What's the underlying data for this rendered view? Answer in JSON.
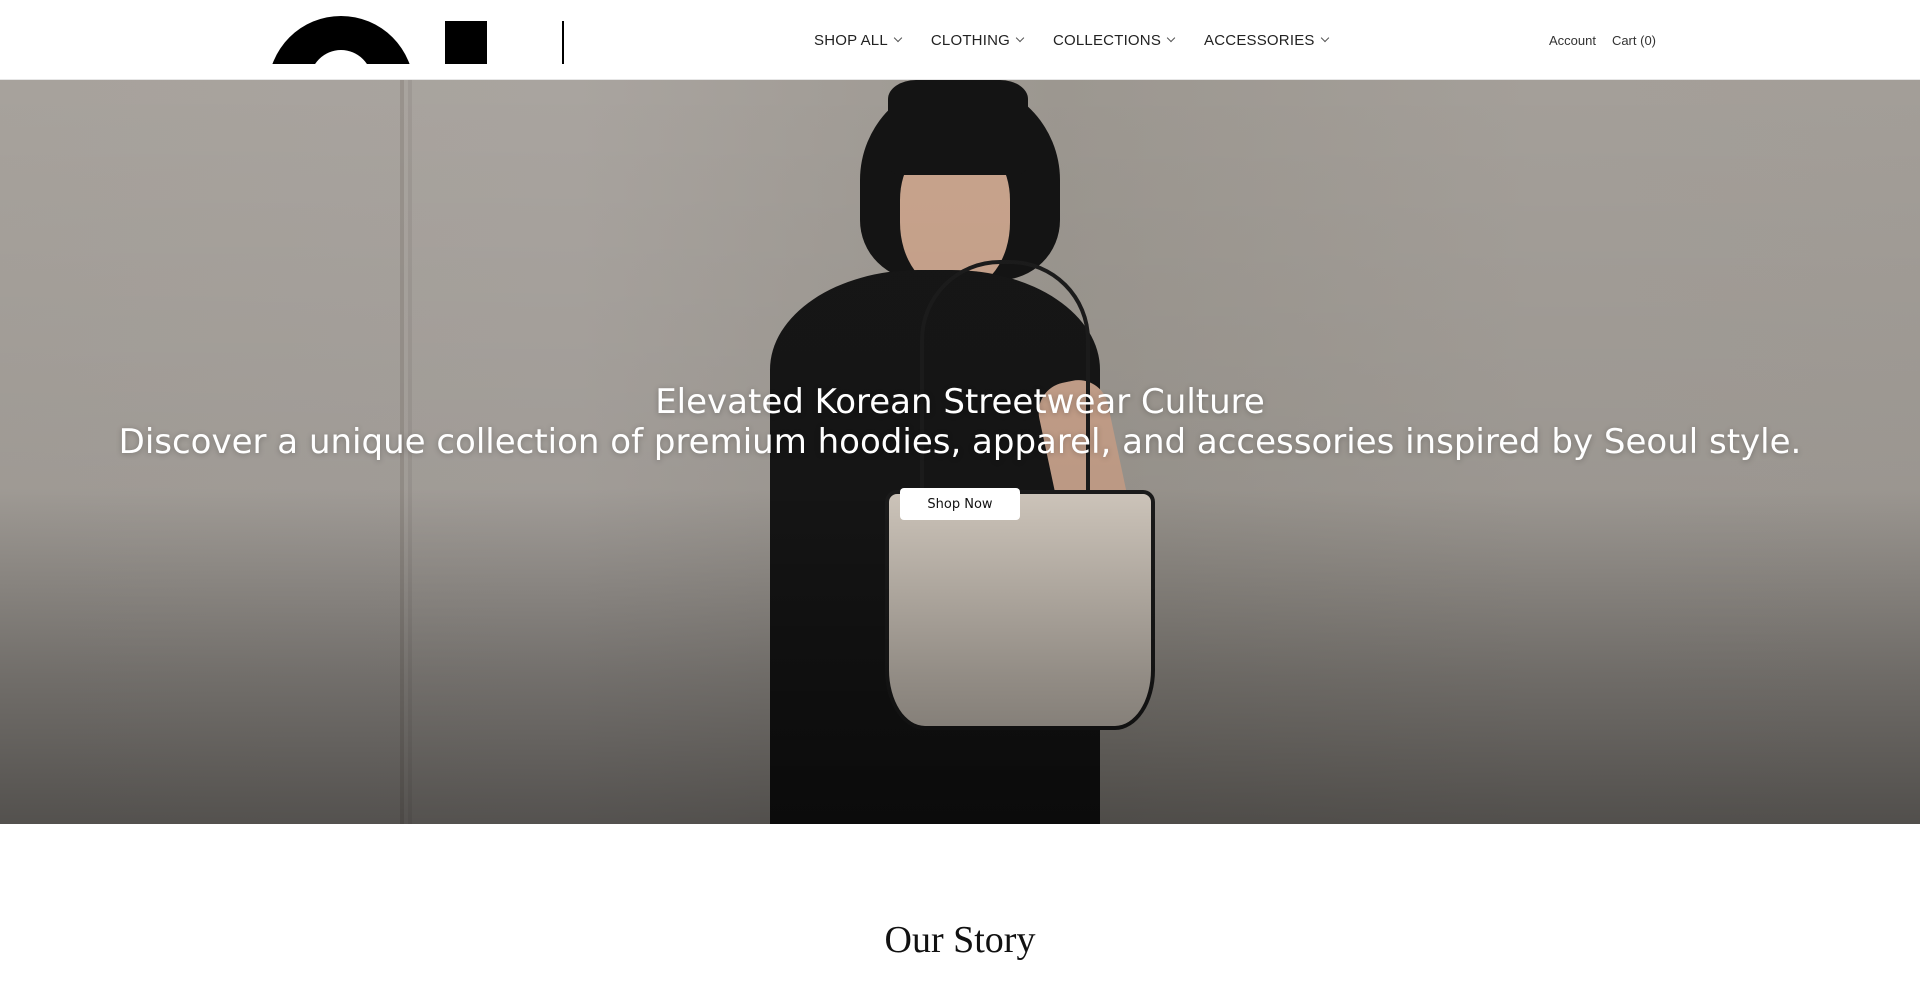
{
  "header": {
    "nav": [
      {
        "label": "SHOP ALL"
      },
      {
        "label": "CLOTHING"
      },
      {
        "label": "COLLECTIONS"
      },
      {
        "label": "ACCESSORIES"
      }
    ],
    "account_label": "Account",
    "cart_label": "Cart (0)"
  },
  "hero": {
    "title": "Elevated Korean Streetwear Culture",
    "subtitle": "Discover a unique collection of premium hoodies, apparel, and accessories inspired by Seoul style.",
    "cta_label": "Shop Now"
  },
  "story": {
    "title": "Our Story"
  },
  "icons": {
    "nav_dropdown": "chevron-down-icon"
  },
  "colors": {
    "header_bg": "#ffffff",
    "hero_bg": "#a7a29c",
    "cta_bg": "#ffffff",
    "text_dark": "#111111"
  }
}
